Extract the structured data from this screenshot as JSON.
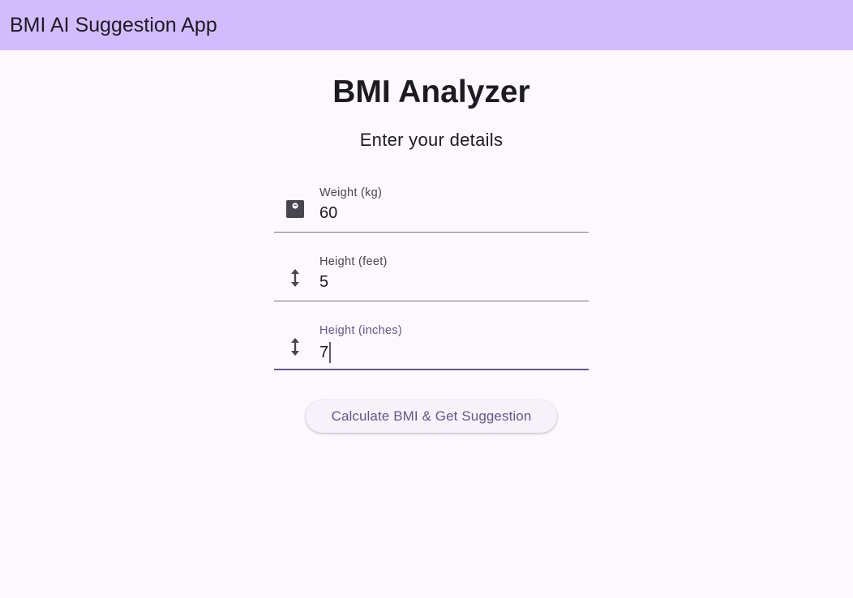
{
  "app_bar": {
    "title": "BMI AI Suggestion App",
    "background": "#d3bcfd"
  },
  "main": {
    "title": "BMI Analyzer",
    "subtitle": "Enter your details"
  },
  "form": {
    "fields": [
      {
        "label": "Weight (kg)",
        "value": "60",
        "icon": "scale-icon",
        "focused": false
      },
      {
        "label": "Height (feet)",
        "value": "5",
        "icon": "height-icon",
        "focused": false
      },
      {
        "label": "Height (inches)",
        "value": "7",
        "icon": "height-icon",
        "focused": true
      }
    ],
    "submit_label": "Calculate BMI & Get Suggestion"
  },
  "colors": {
    "background": "#fdf7ff",
    "primary": "#65558f",
    "outline": "#79747e",
    "text": "#1d1b20"
  }
}
